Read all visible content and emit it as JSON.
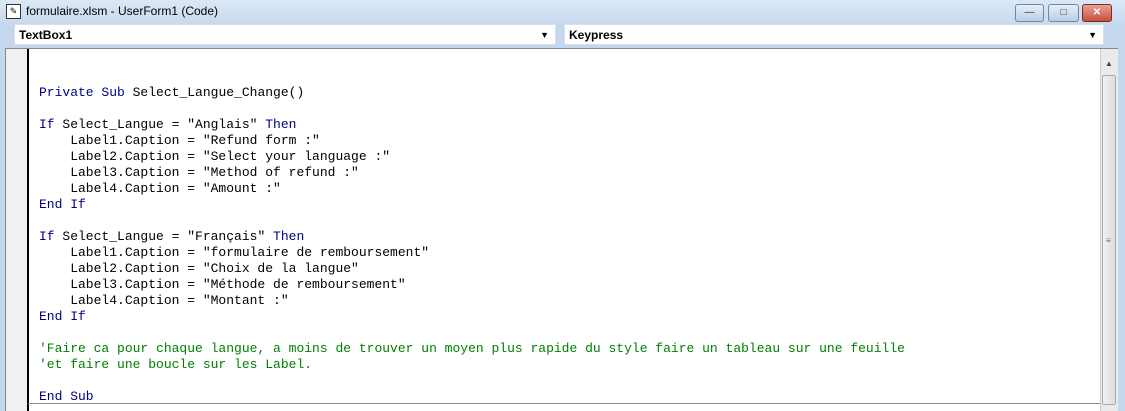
{
  "window": {
    "title": "formulaire.xlsm - UserForm1 (Code)",
    "minimize": "—",
    "maximize": "□",
    "close": "✕"
  },
  "object_combo": {
    "value": "TextBox1"
  },
  "procedure_combo": {
    "value": "Keypress"
  },
  "code": [
    [
      [
        "Private Sub ",
        "kw"
      ],
      [
        "Select_Langue_Change()",
        ""
      ]
    ],
    [],
    [
      [
        "If ",
        "kw"
      ],
      [
        "Select_Langue = \"Anglais\" ",
        ""
      ],
      [
        "Then",
        "kw"
      ]
    ],
    [
      [
        "    Label1.Caption = \"Refund form :\"",
        ""
      ]
    ],
    [
      [
        "    Label2.Caption = \"Select your language :\"",
        ""
      ]
    ],
    [
      [
        "    Label3.Caption = \"Method of refund :\"",
        ""
      ]
    ],
    [
      [
        "    Label4.Caption = \"Amount :\"",
        ""
      ]
    ],
    [
      [
        "End If",
        "kw"
      ]
    ],
    [],
    [
      [
        "If ",
        "kw"
      ],
      [
        "Select_Langue = \"Français\" ",
        ""
      ],
      [
        "Then",
        "kw"
      ]
    ],
    [
      [
        "    Label1.Caption = \"formulaire de remboursement\"",
        ""
      ]
    ],
    [
      [
        "    Label2.Caption = \"Choix de la langue\"",
        ""
      ]
    ],
    [
      [
        "    Label3.Caption = \"Méthode de remboursement\"",
        ""
      ]
    ],
    [
      [
        "    Label4.Caption = \"Montant :\"",
        ""
      ]
    ],
    [
      [
        "End If",
        "kw"
      ]
    ],
    [],
    [
      [
        "'Faire ca pour chaque langue, a moins de trouver un moyen plus rapide du style faire un tableau sur une feuille",
        "cm"
      ]
    ],
    [
      [
        "'et faire une boucle sur les Label.",
        "cm"
      ]
    ],
    [],
    [
      [
        "End Sub",
        "kw"
      ]
    ]
  ]
}
